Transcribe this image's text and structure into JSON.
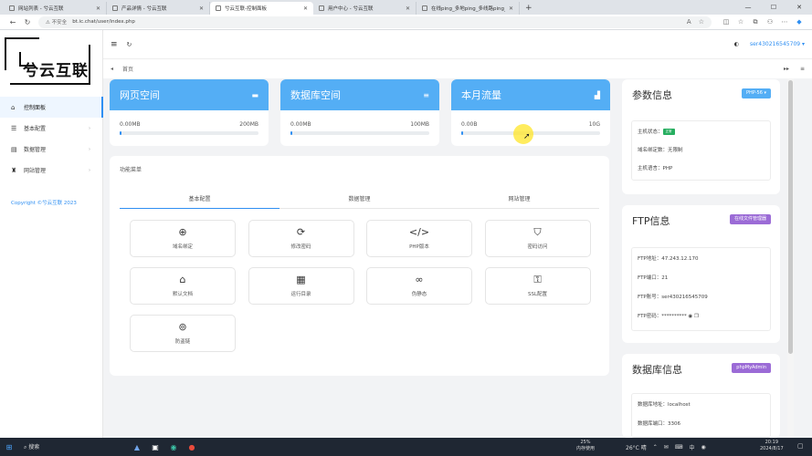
{
  "browser": {
    "tabs": [
      {
        "title": "网站列表 - 兮云互联",
        "active": false
      },
      {
        "title": "产品详情 - 兮云互联",
        "active": false
      },
      {
        "title": "兮云互联-控制面板",
        "active": true
      },
      {
        "title": "用户中心 - 兮云互联",
        "active": false
      },
      {
        "title": "在线ping_多地ping_多线路ping_",
        "active": false
      }
    ],
    "new_tab": "+",
    "controls": {
      "minimize": "—",
      "maximize": "☐",
      "close": "✕"
    },
    "security": "⚠ 不安全",
    "url": "bt.ic.chat/user/index.php",
    "zoom_icon": "A",
    "star_icon": "☆"
  },
  "sidebar": {
    "logo_text": "兮云互联",
    "items": [
      {
        "label": "控制面板",
        "icon": "⌂",
        "active": true,
        "arrow": ""
      },
      {
        "label": "基本配置",
        "icon": "☰",
        "active": false,
        "arrow": "›"
      },
      {
        "label": "数据管理",
        "icon": "▤",
        "active": false,
        "arrow": "›"
      },
      {
        "label": "网站管理",
        "icon": "♜",
        "active": false,
        "arrow": "›"
      }
    ],
    "copyright": "Copyright ©兮云互联 2023"
  },
  "header": {
    "menu_icon": "≡",
    "refresh_icon": "↻",
    "theme_icon": "◐",
    "user_name": "ser430216545709 ▾"
  },
  "breadcrumb": {
    "home": "首页",
    "prev": "◂",
    "right_icons": [
      "▸▸",
      "≡"
    ]
  },
  "stats": [
    {
      "title": "网页空间",
      "icon": "▬",
      "used": "0.00MB",
      "total": "200MB",
      "fill": 0
    },
    {
      "title": "数据库空间",
      "icon": "≡",
      "used": "0.00MB",
      "total": "100MB",
      "fill": 0
    },
    {
      "title": "本月流量",
      "icon": "▟",
      "used": "0.00B",
      "total": "10G",
      "fill": 0
    }
  ],
  "functions": {
    "title": "功能菜单",
    "tabs": [
      "基本配置",
      "数据管理",
      "网站管理"
    ],
    "active_tab": 0,
    "items": [
      {
        "label": "域名绑定",
        "icon": "⊕"
      },
      {
        "label": "修改密码",
        "icon": "⟳"
      },
      {
        "label": "PHP版本",
        "icon": "</>"
      },
      {
        "label": "密码访问",
        "icon": "⛉"
      },
      {
        "label": "默认文档",
        "icon": "⌂"
      },
      {
        "label": "运行目录",
        "icon": "▦"
      },
      {
        "label": "伪静态",
        "icon": "∞"
      },
      {
        "label": "SSL配置",
        "icon": "⚿"
      },
      {
        "label": "防盗链",
        "icon": "⊚"
      }
    ]
  },
  "params": {
    "title": "参数信息",
    "badge": "PHP-56 ▾",
    "badge_color": "#54aef5",
    "rows": [
      {
        "label": "主机状态：",
        "value": "",
        "tag": "正常"
      },
      {
        "label": "域名绑定数：",
        "value": "无限制",
        "tag": ""
      },
      {
        "label": "主机语言：",
        "value": "PHP",
        "tag": ""
      }
    ]
  },
  "ftp": {
    "title": "FTP信息",
    "badge": "在线文件管理器",
    "badge_color": "#9b6bd6",
    "rows": [
      {
        "label": "FTP地址：",
        "value": "47.243.12.170"
      },
      {
        "label": "FTP端口：",
        "value": "21"
      },
      {
        "label": "FTP账号：",
        "value": "ser430216545709"
      },
      {
        "label": "FTP密码：",
        "value": "********** ◉ ❐"
      }
    ]
  },
  "database": {
    "title": "数据库信息",
    "badge": "phpMyAdmin",
    "badge_color": "#9b6bd6",
    "rows": [
      {
        "label": "数据库地址：",
        "value": "localhost"
      },
      {
        "label": "数据库端口：",
        "value": "3306"
      }
    ]
  },
  "taskbar": {
    "start_icon": "⊞",
    "search_label": "⌕ 搜索",
    "mem_percent": "25%",
    "mem_label": "内存使用",
    "weather": "26°C 晴",
    "tray_icons": [
      "⌃",
      "✉",
      "⌨",
      "中",
      "◉"
    ],
    "time": "20:19",
    "date": "2024/8/17",
    "notif_icon": "▢"
  }
}
